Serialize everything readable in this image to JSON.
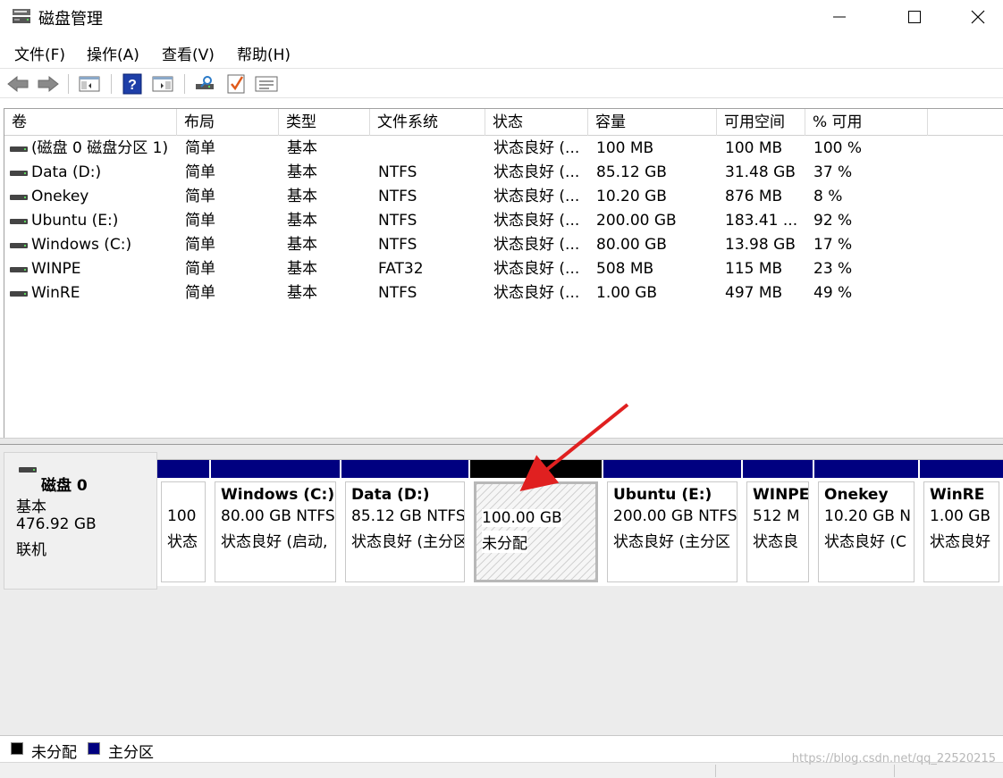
{
  "window": {
    "title": "磁盘管理",
    "minimize_glyph": "—",
    "maximize_glyph": "☐",
    "close_glyph": "✕"
  },
  "menu": [
    {
      "label": "文件(F)"
    },
    {
      "label": "操作(A)"
    },
    {
      "label": "查看(V)"
    },
    {
      "label": "帮助(H)"
    }
  ],
  "toolbar": {
    "icons": [
      "back-arrow-icon",
      "forward-arrow-icon",
      "show-hide-console-tree-icon",
      "help-icon",
      "action-pane-icon",
      "rescan-disks-icon",
      "check-icon",
      "properties-list-icon"
    ]
  },
  "volume_list": {
    "columns": [
      "卷",
      "布局",
      "类型",
      "文件系统",
      "状态",
      "容量",
      "可用空间",
      "% 可用"
    ],
    "rows": [
      {
        "volume": "(磁盘 0 磁盘分区 1)",
        "layout": "简单",
        "type": "基本",
        "fs": "",
        "status": "状态良好 (...",
        "capacity": "100 MB",
        "free": "100 MB",
        "pct": "100 %"
      },
      {
        "volume": "Data (D:)",
        "layout": "简单",
        "type": "基本",
        "fs": "NTFS",
        "status": "状态良好 (...",
        "capacity": "85.12 GB",
        "free": "31.48 GB",
        "pct": "37 %"
      },
      {
        "volume": "Onekey",
        "layout": "简单",
        "type": "基本",
        "fs": "NTFS",
        "status": "状态良好 (...",
        "capacity": "10.20 GB",
        "free": "876 MB",
        "pct": "8 %"
      },
      {
        "volume": "Ubuntu (E:)",
        "layout": "简单",
        "type": "基本",
        "fs": "NTFS",
        "status": "状态良好 (...",
        "capacity": "200.00 GB",
        "free": "183.41 ...",
        "pct": "92 %"
      },
      {
        "volume": "Windows (C:)",
        "layout": "简单",
        "type": "基本",
        "fs": "NTFS",
        "status": "状态良好 (...",
        "capacity": "80.00 GB",
        "free": "13.98 GB",
        "pct": "17 %"
      },
      {
        "volume": "WINPE",
        "layout": "简单",
        "type": "基本",
        "fs": "FAT32",
        "status": "状态良好 (...",
        "capacity": "508 MB",
        "free": "115 MB",
        "pct": "23 %"
      },
      {
        "volume": "WinRE",
        "layout": "简单",
        "type": "基本",
        "fs": "NTFS",
        "status": "状态良好 (...",
        "capacity": "1.00 GB",
        "free": "497 MB",
        "pct": "49 %"
      }
    ]
  },
  "disk": {
    "name": "磁盘 0",
    "type": "基本",
    "size": "476.92 GB",
    "state": "联机"
  },
  "partitions": [
    {
      "title": "",
      "line1": "100",
      "line2": "状态",
      "kind": "primary"
    },
    {
      "title": "Windows  (C:)",
      "line1": "80.00 GB NTFS",
      "line2": "状态良好 (启动,",
      "kind": "primary"
    },
    {
      "title": "Data  (D:)",
      "line1": "85.12 GB NTFS",
      "line2": "状态良好 (主分区",
      "kind": "primary"
    },
    {
      "title": "",
      "line1": "100.00 GB",
      "line2": "未分配",
      "kind": "unallocated"
    },
    {
      "title": "Ubuntu  (E:)",
      "line1": "200.00 GB NTFS",
      "line2": "状态良好 (主分区",
      "kind": "primary"
    },
    {
      "title": "WINPE",
      "line1": "512 M",
      "line2": "状态良",
      "kind": "primary"
    },
    {
      "title": "Onekey",
      "line1": "10.20 GB N",
      "line2": "状态良好 (C",
      "kind": "primary"
    },
    {
      "title": "WinRE",
      "line1": "1.00 GB",
      "line2": "状态良好",
      "kind": "primary"
    }
  ],
  "legend": [
    {
      "label": "未分配",
      "color": "#000000"
    },
    {
      "label": "主分区",
      "color": "#000080"
    }
  ],
  "colors": {
    "primary_bar": "#000080",
    "unallocated_bar": "#000000",
    "annotation_arrow": "#e02020"
  },
  "watermark": "https://blog.csdn.net/qq_22520215"
}
